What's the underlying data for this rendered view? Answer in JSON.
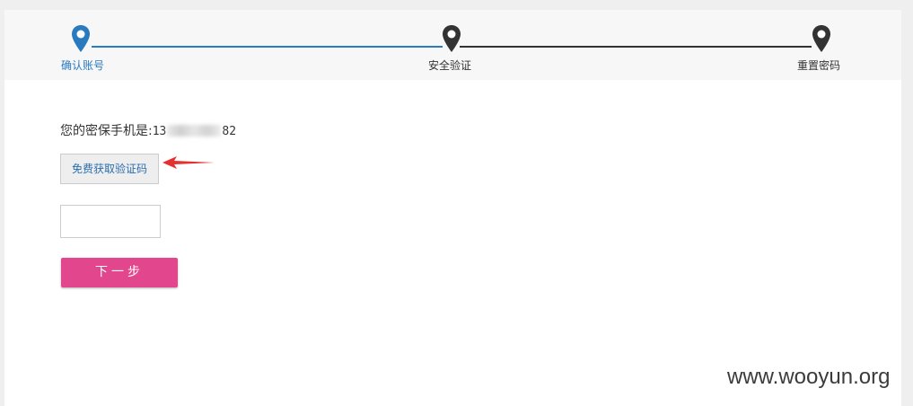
{
  "steps": [
    {
      "label": "确认账号",
      "active": true,
      "color": "#2a7ac0"
    },
    {
      "label": "安全验证",
      "active": false,
      "color": "#333333"
    },
    {
      "label": "重置密码",
      "active": false,
      "color": "#333333"
    }
  ],
  "form": {
    "phone_label": "您的密保手机是:",
    "phone_prefix": "13",
    "phone_suffix": "82",
    "get_code_button": "免费获取验证码",
    "code_input_value": "",
    "next_button": "下一步"
  },
  "watermark": "www.wooyun.org",
  "colors": {
    "accent_blue": "#2a7ac0",
    "next_button": "#e2468c",
    "annotation_arrow": "#e53030"
  }
}
